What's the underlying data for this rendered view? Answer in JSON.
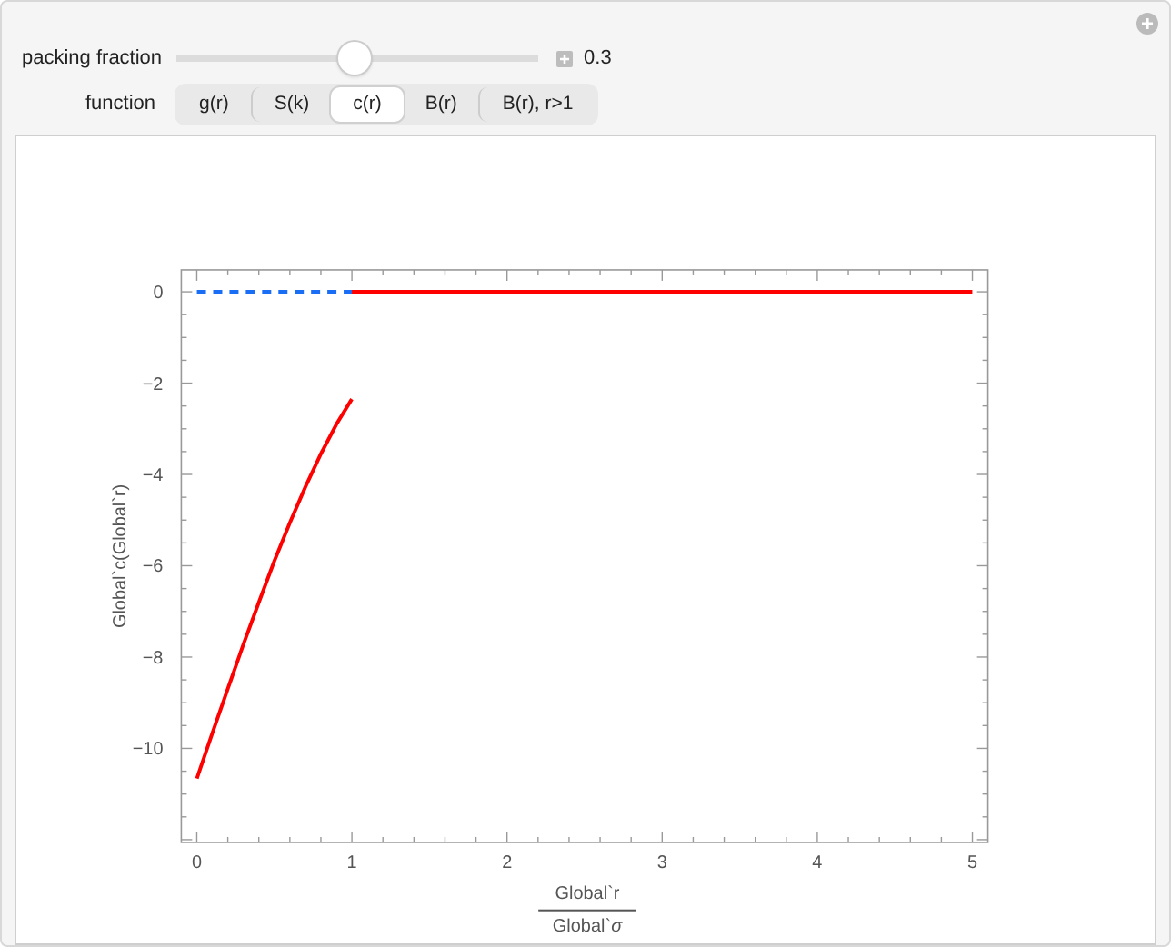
{
  "controls": {
    "slider": {
      "label": "packing fraction",
      "level": 0.49,
      "value": "0.3"
    },
    "function": {
      "label": "function",
      "options": [
        {
          "label": "g(r)",
          "selected": false
        },
        {
          "label": "S(k)",
          "selected": false
        },
        {
          "label": "c(r)",
          "selected": true
        },
        {
          "label": "B(r)",
          "selected": false
        },
        {
          "label": "B(r), r>1",
          "selected": false
        }
      ]
    }
  },
  "plot": {
    "chart_data": {
      "type": "line",
      "ylabel": "Global`c(Global`r)",
      "xlabel": {
        "numerator": "Global`r",
        "denominator": "Global`*σ*"
      },
      "x": [
        0,
        0.1,
        0.2,
        0.3,
        0.4,
        0.5,
        0.6,
        0.7,
        0.8,
        0.9,
        1,
        2,
        3,
        4,
        5
      ],
      "series": [
        {
          "color": "#ff0000",
          "values": [
            -10.66,
            -9.67,
            -8.69,
            -7.73,
            -6.8,
            -5.9,
            -5.06,
            -4.27,
            -3.55,
            -2.9,
            -2.35,
            null,
            null,
            null,
            null
          ]
        },
        {
          "color": "#ff0000",
          "values": [
            null,
            null,
            null,
            null,
            null,
            null,
            null,
            null,
            null,
            null,
            0,
            0,
            0,
            0,
            0
          ]
        },
        {
          "color": "#1a6ef5",
          "line_style": "dashed",
          "values": [
            0,
            0,
            0,
            0,
            0,
            0,
            0,
            0,
            0,
            0,
            0,
            null,
            null,
            null,
            null
          ]
        }
      ],
      "xlim": [
        -0.1,
        5.1
      ],
      "ylim": [
        -12.06,
        0.48
      ],
      "xticks": [
        0,
        1,
        2,
        3,
        4,
        5
      ],
      "yticks": [
        {
          "value": 0,
          "label": "0"
        },
        {
          "value": -2,
          "label": "−2"
        },
        {
          "value": -4,
          "label": "−4"
        },
        {
          "value": -6,
          "label": "−6"
        },
        {
          "value": -8,
          "label": "−8"
        },
        {
          "value": -10,
          "label": "−10"
        }
      ]
    }
  }
}
